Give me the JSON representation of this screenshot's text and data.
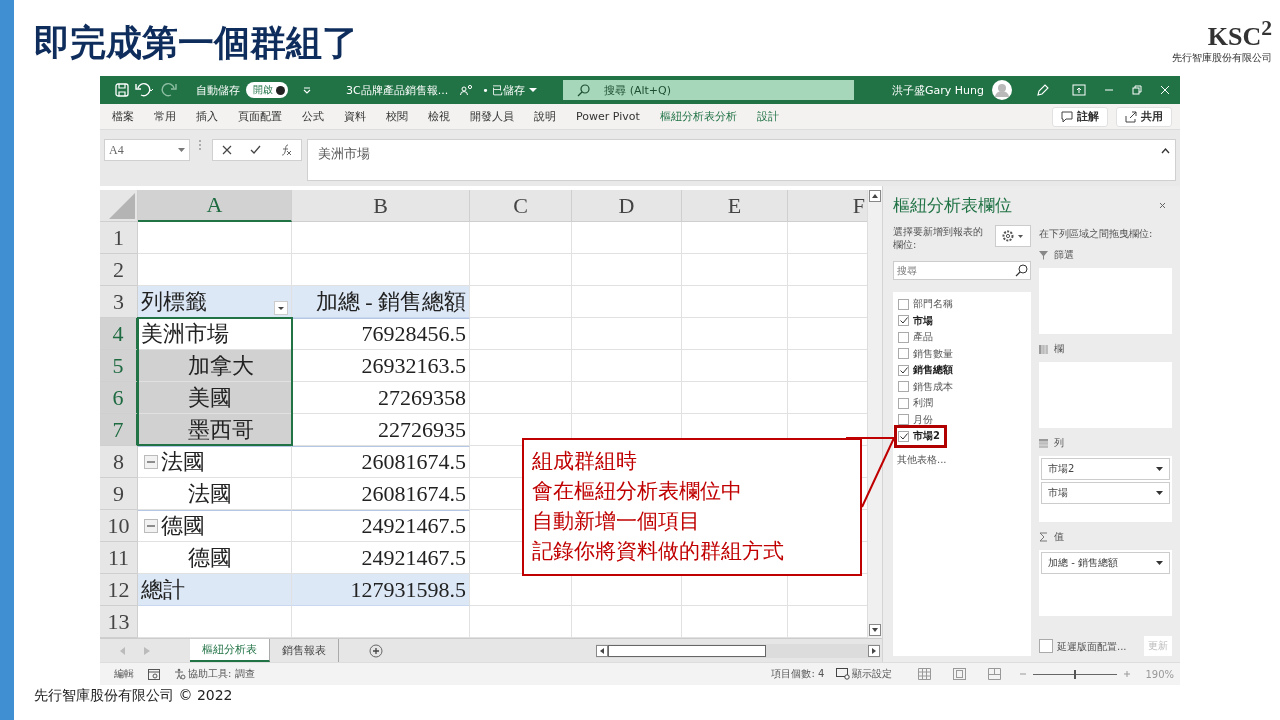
{
  "slide": {
    "title": "即完成第一個群組了",
    "logo": {
      "mark": "KSC$^{2}$",
      "company": "先行智庫股份有限公司"
    },
    "footer": "先行智庫股份有限公司 © 2022"
  },
  "excel": {
    "titlebar": {
      "autosave": "自動儲存",
      "autosave_toggle": {
        "label": "開啟",
        "on": true
      },
      "filename": "3C品牌產品銷售報...",
      "saved": "• 已儲存",
      "search": {
        "placeholder": "搜尋 (Alt+Q)"
      },
      "user": "洪子盛Gary Hung"
    },
    "ribbon_tabs": [
      {
        "label": "檔案",
        "contextual": false
      },
      {
        "label": "常用",
        "contextual": false
      },
      {
        "label": "插入",
        "contextual": false
      },
      {
        "label": "頁面配置",
        "contextual": false
      },
      {
        "label": "公式",
        "contextual": false
      },
      {
        "label": "資料",
        "contextual": false
      },
      {
        "label": "校閱",
        "contextual": false
      },
      {
        "label": "檢視",
        "contextual": false
      },
      {
        "label": "開發人員",
        "contextual": false
      },
      {
        "label": "說明",
        "contextual": false
      },
      {
        "label": "Power Pivot",
        "contextual": false
      },
      {
        "label": "樞紐分析表分析",
        "contextual": true
      },
      {
        "label": "設計",
        "contextual": true
      }
    ],
    "ribbon_buttons": [
      "註解",
      "共用"
    ],
    "formula_bar": {
      "name_box": "A4",
      "formula": "美洲市場"
    },
    "grid": {
      "columns": [
        {
          "label": "A",
          "selected": true
        },
        {
          "label": "B",
          "selected": false
        },
        {
          "label": "C",
          "selected": false
        },
        {
          "label": "D",
          "selected": false
        },
        {
          "label": "E",
          "selected": false
        },
        {
          "label": "F",
          "selected": false
        }
      ],
      "rows": [
        {
          "number": "1",
          "kind": "empty",
          "selected": false
        },
        {
          "number": "2",
          "kind": "empty",
          "selected": false
        },
        {
          "number": "3",
          "kind": "header",
          "selected": false,
          "label": "列標籤",
          "value": "加總 - 銷售總額"
        },
        {
          "number": "4",
          "kind": "group",
          "selected": true,
          "collapse": false,
          "label": "美洲市場",
          "value": "76928456.5"
        },
        {
          "number": "5",
          "kind": "item",
          "selected": true,
          "label": "加拿大",
          "value": "26932163.5"
        },
        {
          "number": "6",
          "kind": "item",
          "selected": true,
          "label": "美國",
          "value": "27269358"
        },
        {
          "number": "7",
          "kind": "item",
          "selected": true,
          "label": "墨西哥",
          "value": "22726935"
        },
        {
          "number": "8",
          "kind": "group",
          "selected": false,
          "collapse": true,
          "label": "法國",
          "value": "26081674.5"
        },
        {
          "number": "9",
          "kind": "item",
          "selected": false,
          "label": "法國",
          "value": "26081674.5"
        },
        {
          "number": "10",
          "kind": "group",
          "selected": false,
          "collapse": true,
          "label": "德國",
          "value": "24921467.5"
        },
        {
          "number": "11",
          "kind": "item",
          "selected": false,
          "label": "德國",
          "value": "24921467.5"
        },
        {
          "number": "12",
          "kind": "total",
          "selected": false,
          "label": "總計",
          "value": "127931598.5"
        },
        {
          "number": "13",
          "kind": "empty",
          "selected": false
        }
      ]
    },
    "callout": {
      "lines": [
        "組成群組時",
        "會在樞紐分析表欄位中",
        "自動新增一個項目",
        "記錄你將資料做的群組方式"
      ]
    },
    "sheet_tabs": [
      {
        "label": "樞紐分析表",
        "selected": true
      },
      {
        "label": "銷售報表",
        "selected": false
      }
    ],
    "pivot_pane": {
      "title": "樞紐分析表欄位",
      "choose_label": "選擇要新增到報表的欄位:",
      "search": {
        "placeholder": "搜尋"
      },
      "fields": [
        {
          "label": "部門名稱",
          "checked": false,
          "highlighted": false
        },
        {
          "label": "市場",
          "checked": true,
          "highlighted": false
        },
        {
          "label": "產品",
          "checked": false,
          "highlighted": false
        },
        {
          "label": "銷售數量",
          "checked": false,
          "highlighted": false
        },
        {
          "label": "銷售總額",
          "checked": true,
          "highlighted": false
        },
        {
          "label": "銷售成本",
          "checked": false,
          "highlighted": false
        },
        {
          "label": "利潤",
          "checked": false,
          "highlighted": false
        },
        {
          "label": "月份",
          "checked": false,
          "highlighted": false
        },
        {
          "label": "市場2",
          "checked": true,
          "highlighted": true
        }
      ],
      "more_tables": "其他表格...",
      "drag_label": "在下列區域之間拖曳欄位:",
      "areas": [
        {
          "kind": "filter",
          "label": "篩選"
        },
        {
          "kind": "columns",
          "label": "欄"
        },
        {
          "kind": "rows",
          "label": "列",
          "items": [
            "市場2",
            "市場"
          ]
        },
        {
          "kind": "values",
          "label": "值",
          "items": [
            "加總 - 銷售總額"
          ]
        }
      ],
      "defer": {
        "label": "延遲版面配置...",
        "checked": false
      },
      "update": {
        "label": "更新",
        "disabled": true
      }
    },
    "status_bar": {
      "mode": "編輯",
      "accessibility": "協助工具: 調查",
      "count": "項目個數: 4",
      "display": "顯示設定",
      "zoom_slider": {
        "level": 0.5
      },
      "zoom": "190%"
    }
  }
}
